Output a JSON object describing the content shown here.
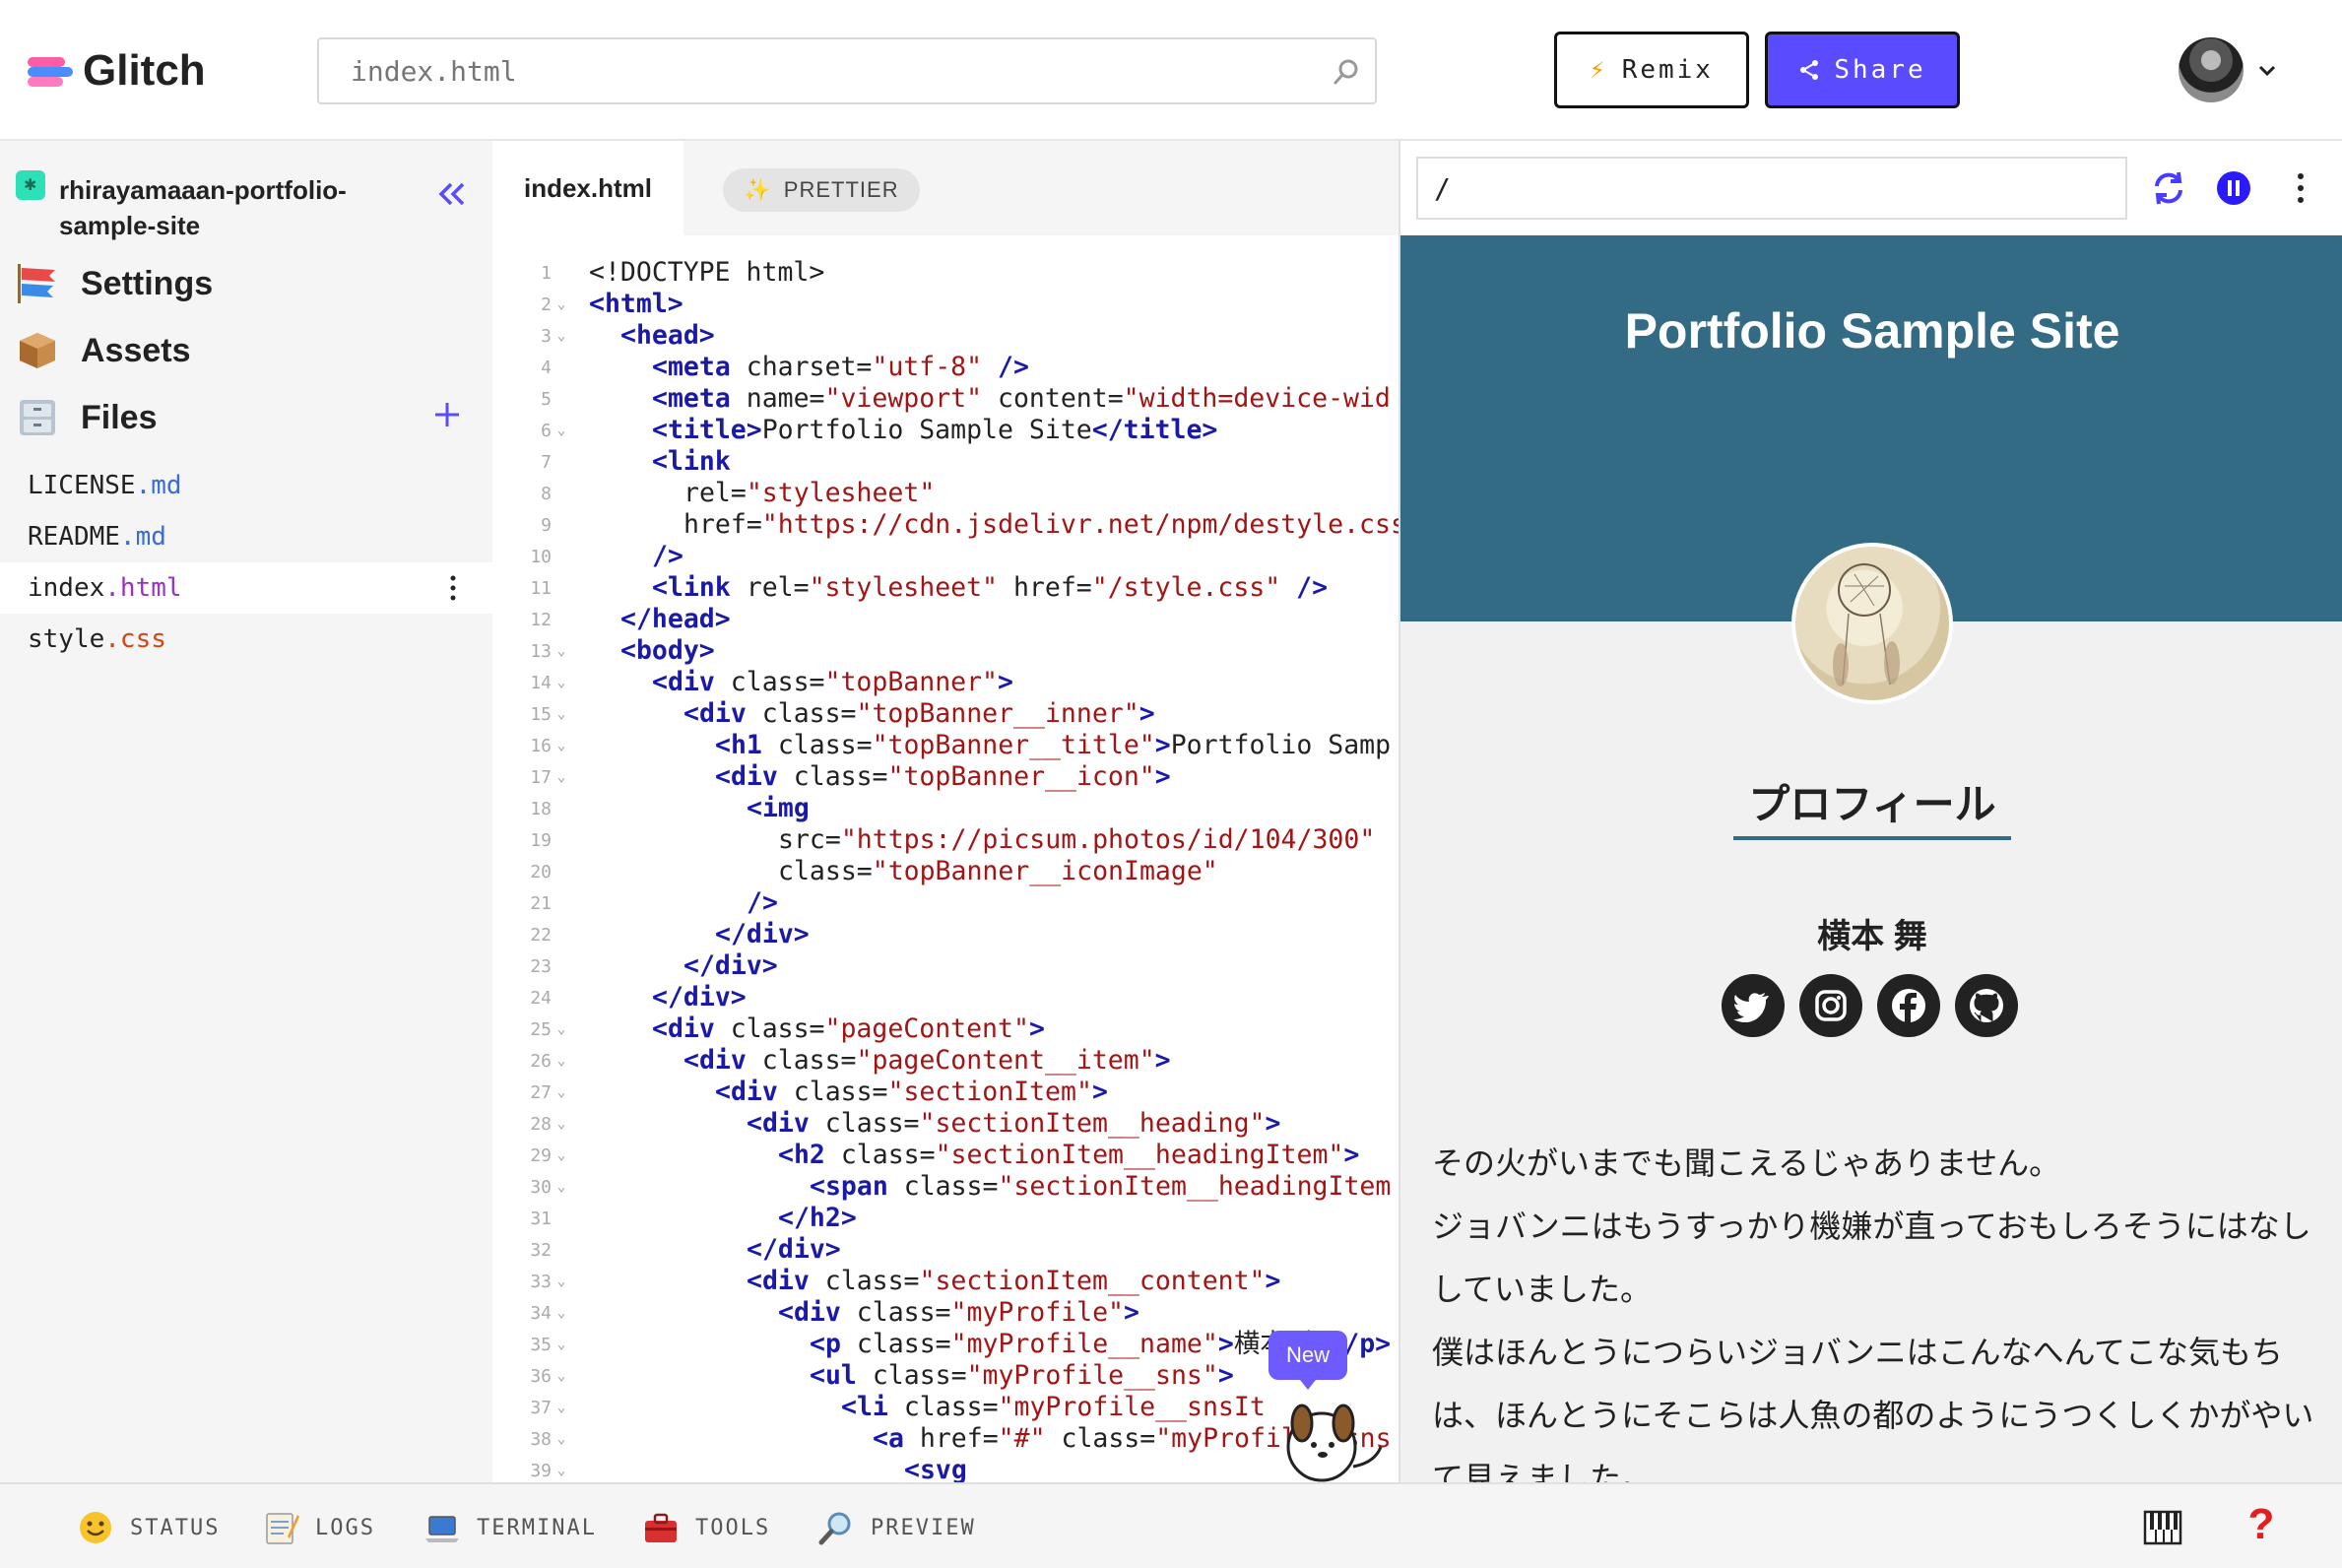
{
  "app": {
    "logo_text": "Glitch",
    "search_placeholder": "index.html",
    "remix_label": "Remix",
    "share_label": "Share",
    "accent_color": "#5a4bff"
  },
  "sidebar": {
    "project_name": "rhirayamaaan-portfolio-sample-site",
    "nav": [
      {
        "label": "Settings",
        "icon": "carp-streamer-icon"
      },
      {
        "label": "Assets",
        "icon": "box-icon"
      },
      {
        "label": "Files",
        "icon": "file-cabinet-icon"
      }
    ],
    "files": [
      {
        "base": "LICENSE",
        "ext": ".md",
        "ext_color": "#3a6bd8"
      },
      {
        "base": "README",
        "ext": ".md",
        "ext_color": "#3a6bd8"
      },
      {
        "base": "index",
        "ext": ".html",
        "ext_color": "#9b32c8"
      },
      {
        "base": "style",
        "ext": ".css",
        "ext_color": "#d84315"
      }
    ]
  },
  "editor": {
    "tab_label": "index.html",
    "prettier_label": "PRETTIER",
    "new_badge": "New",
    "lines": [
      {
        "n": "1",
        "fold": false,
        "indent": 0,
        "parts": [
          [
            "p",
            "<!DOCTYPE html>"
          ]
        ]
      },
      {
        "n": "2",
        "fold": true,
        "indent": 0,
        "parts": [
          [
            "t",
            "<html>"
          ]
        ]
      },
      {
        "n": "3",
        "fold": true,
        "indent": 1,
        "parts": [
          [
            "t",
            "<head>"
          ]
        ]
      },
      {
        "n": "4",
        "fold": false,
        "indent": 2,
        "parts": [
          [
            "t",
            "<meta"
          ],
          [
            "p",
            " charset="
          ],
          [
            "s",
            "\"utf-8\""
          ],
          [
            "t",
            " />"
          ]
        ]
      },
      {
        "n": "5",
        "fold": false,
        "indent": 2,
        "parts": [
          [
            "t",
            "<meta"
          ],
          [
            "p",
            " name="
          ],
          [
            "s",
            "\"viewport\""
          ],
          [
            "p",
            " content="
          ],
          [
            "s",
            "\"width=device-wid"
          ]
        ]
      },
      {
        "n": "6",
        "fold": true,
        "indent": 2,
        "parts": [
          [
            "t",
            "<title>"
          ],
          [
            "p",
            "Portfolio Sample Site"
          ],
          [
            "t",
            "</title>"
          ]
        ]
      },
      {
        "n": "7",
        "fold": false,
        "indent": 2,
        "parts": [
          [
            "t",
            "<link"
          ]
        ]
      },
      {
        "n": "8",
        "fold": false,
        "indent": 3,
        "parts": [
          [
            "p",
            "rel="
          ],
          [
            "s",
            "\"stylesheet\""
          ]
        ]
      },
      {
        "n": "9",
        "fold": false,
        "indent": 3,
        "parts": [
          [
            "p",
            "href="
          ],
          [
            "s",
            "\"https://cdn.jsdelivr.net/npm/destyle.css"
          ]
        ]
      },
      {
        "n": "10",
        "fold": false,
        "indent": 2,
        "parts": [
          [
            "t",
            "/>"
          ]
        ]
      },
      {
        "n": "11",
        "fold": false,
        "indent": 2,
        "parts": [
          [
            "t",
            "<link"
          ],
          [
            "p",
            " rel="
          ],
          [
            "s",
            "\"stylesheet\""
          ],
          [
            "p",
            " href="
          ],
          [
            "s",
            "\"/style.css\""
          ],
          [
            "t",
            " />"
          ]
        ]
      },
      {
        "n": "12",
        "fold": false,
        "indent": 1,
        "parts": [
          [
            "t",
            "</head>"
          ]
        ]
      },
      {
        "n": "13",
        "fold": true,
        "indent": 1,
        "parts": [
          [
            "t",
            "<body>"
          ]
        ]
      },
      {
        "n": "14",
        "fold": true,
        "indent": 2,
        "parts": [
          [
            "t",
            "<div"
          ],
          [
            "p",
            " class="
          ],
          [
            "s",
            "\"topBanner\""
          ],
          [
            "t",
            ">"
          ]
        ]
      },
      {
        "n": "15",
        "fold": true,
        "indent": 3,
        "parts": [
          [
            "t",
            "<div"
          ],
          [
            "p",
            " class="
          ],
          [
            "s",
            "\"topBanner__inner\""
          ],
          [
            "t",
            ">"
          ]
        ]
      },
      {
        "n": "16",
        "fold": true,
        "indent": 4,
        "parts": [
          [
            "t",
            "<h1"
          ],
          [
            "p",
            " class="
          ],
          [
            "s",
            "\"topBanner__title\""
          ],
          [
            "t",
            ">"
          ],
          [
            "p",
            "Portfolio Samp"
          ]
        ]
      },
      {
        "n": "17",
        "fold": true,
        "indent": 4,
        "parts": [
          [
            "t",
            "<div"
          ],
          [
            "p",
            " class="
          ],
          [
            "s",
            "\"topBanner__icon\""
          ],
          [
            "t",
            ">"
          ]
        ]
      },
      {
        "n": "18",
        "fold": false,
        "indent": 5,
        "parts": [
          [
            "t",
            "<img"
          ]
        ]
      },
      {
        "n": "19",
        "fold": false,
        "indent": 6,
        "parts": [
          [
            "p",
            "src="
          ],
          [
            "s",
            "\"https://picsum.photos/id/104/300\""
          ]
        ]
      },
      {
        "n": "20",
        "fold": false,
        "indent": 6,
        "parts": [
          [
            "p",
            "class="
          ],
          [
            "s",
            "\"topBanner__iconImage\""
          ]
        ]
      },
      {
        "n": "21",
        "fold": false,
        "indent": 5,
        "parts": [
          [
            "t",
            "/>"
          ]
        ]
      },
      {
        "n": "22",
        "fold": false,
        "indent": 4,
        "parts": [
          [
            "t",
            "</div>"
          ]
        ]
      },
      {
        "n": "23",
        "fold": false,
        "indent": 3,
        "parts": [
          [
            "t",
            "</div>"
          ]
        ]
      },
      {
        "n": "24",
        "fold": false,
        "indent": 2,
        "parts": [
          [
            "t",
            "</div>"
          ]
        ]
      },
      {
        "n": "25",
        "fold": true,
        "indent": 2,
        "parts": [
          [
            "t",
            "<div"
          ],
          [
            "p",
            " class="
          ],
          [
            "s",
            "\"pageContent\""
          ],
          [
            "t",
            ">"
          ]
        ]
      },
      {
        "n": "26",
        "fold": true,
        "indent": 3,
        "parts": [
          [
            "t",
            "<div"
          ],
          [
            "p",
            " class="
          ],
          [
            "s",
            "\"pageContent__item\""
          ],
          [
            "t",
            ">"
          ]
        ]
      },
      {
        "n": "27",
        "fold": true,
        "indent": 4,
        "parts": [
          [
            "t",
            "<div"
          ],
          [
            "p",
            " class="
          ],
          [
            "s",
            "\"sectionItem\""
          ],
          [
            "t",
            ">"
          ]
        ]
      },
      {
        "n": "28",
        "fold": true,
        "indent": 5,
        "parts": [
          [
            "t",
            "<div"
          ],
          [
            "p",
            " class="
          ],
          [
            "s",
            "\"sectionItem__heading\""
          ],
          [
            "t",
            ">"
          ]
        ]
      },
      {
        "n": "29",
        "fold": true,
        "indent": 6,
        "parts": [
          [
            "t",
            "<h2"
          ],
          [
            "p",
            " class="
          ],
          [
            "s",
            "\"sectionItem__headingItem\""
          ],
          [
            "t",
            ">"
          ]
        ]
      },
      {
        "n": "30",
        "fold": true,
        "indent": 7,
        "parts": [
          [
            "t",
            "<span"
          ],
          [
            "p",
            " class="
          ],
          [
            "s",
            "\"sectionItem__headingItem"
          ]
        ]
      },
      {
        "n": "31",
        "fold": false,
        "indent": 6,
        "parts": [
          [
            "t",
            "</h2>"
          ]
        ]
      },
      {
        "n": "32",
        "fold": false,
        "indent": 5,
        "parts": [
          [
            "t",
            "</div>"
          ]
        ]
      },
      {
        "n": "33",
        "fold": true,
        "indent": 5,
        "parts": [
          [
            "t",
            "<div"
          ],
          [
            "p",
            " class="
          ],
          [
            "s",
            "\"sectionItem__content\""
          ],
          [
            "t",
            ">"
          ]
        ]
      },
      {
        "n": "34",
        "fold": true,
        "indent": 6,
        "parts": [
          [
            "t",
            "<div"
          ],
          [
            "p",
            " class="
          ],
          [
            "s",
            "\"myProfile\""
          ],
          [
            "t",
            ">"
          ]
        ]
      },
      {
        "n": "35",
        "fold": true,
        "indent": 7,
        "parts": [
          [
            "t",
            "<p"
          ],
          [
            "p",
            " class="
          ],
          [
            "s",
            "\"myProfile__name\""
          ],
          [
            "t",
            ">"
          ],
          [
            "p",
            "横本 舞"
          ],
          [
            "t",
            "</p>"
          ]
        ]
      },
      {
        "n": "36",
        "fold": true,
        "indent": 7,
        "parts": [
          [
            "t",
            "<ul"
          ],
          [
            "p",
            " class="
          ],
          [
            "s",
            "\"myProfile__sns\""
          ],
          [
            "t",
            ">"
          ]
        ]
      },
      {
        "n": "37",
        "fold": true,
        "indent": 8,
        "parts": [
          [
            "t",
            "<li"
          ],
          [
            "p",
            " class="
          ],
          [
            "s",
            "\"myProfile__snsIt"
          ]
        ]
      },
      {
        "n": "38",
        "fold": true,
        "indent": 9,
        "parts": [
          [
            "t",
            "<a"
          ],
          [
            "p",
            " href="
          ],
          [
            "s",
            "\"#\""
          ],
          [
            "p",
            " class="
          ],
          [
            "s",
            "\"myProfile__sns"
          ]
        ]
      },
      {
        "n": "39",
        "fold": true,
        "indent": 10,
        "parts": [
          [
            "t",
            "<svg"
          ]
        ]
      }
    ]
  },
  "preview": {
    "url": "/",
    "banner_title": "Portfolio Sample Site",
    "section_heading": "プロフィール",
    "profile_name": "横本 舞",
    "sns": [
      "twitter-icon",
      "instagram-icon",
      "facebook-icon",
      "github-icon"
    ],
    "paragraphs": [
      "その火がいまでも聞こえるじゃありません。",
      "ジョバンニはもうすっかり機嫌が直っておもしろそうにはなししていました。",
      "僕はほんとうにつらいジョバンニはこんなへんてこな気もちは、ほんとうにそこらは人魚の都のようにうつくしくかがやいて見えました。"
    ],
    "banner_color": "#336b85"
  },
  "bottombar": {
    "items": [
      {
        "label": "STATUS",
        "icon": "smiley-icon"
      },
      {
        "label": "LOGS",
        "icon": "memo-icon"
      },
      {
        "label": "TERMINAL",
        "icon": "laptop-icon"
      },
      {
        "label": "TOOLS",
        "icon": "toolbox-icon"
      },
      {
        "label": "PREVIEW",
        "icon": "magnifier-icon"
      }
    ],
    "help_label": "?"
  }
}
